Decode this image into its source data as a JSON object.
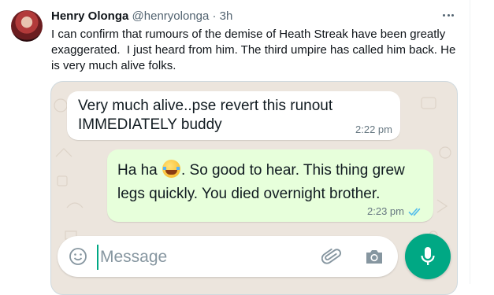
{
  "tweet": {
    "author_name": "Henry Olonga",
    "handle": "@henryolonga",
    "separator": "·",
    "time": "3h",
    "text": "I can confirm that rumours of the demise of Heath Streak have been greatly exaggerated.  I just heard from him. The third umpire has called him back. He is very much alive folks."
  },
  "chat": {
    "incoming": {
      "text": "Very much alive..pse revert this runout\nIMMEDIATELY buddy",
      "time": "2:22 pm"
    },
    "outgoing": {
      "text_before_emoji": "Ha ha ",
      "emoji": "face-with-tears-of-joy",
      "text_after_emoji": ".  So good to hear. This thing grew\nlegs quickly. You died overnight brother.",
      "time": "2:23 pm",
      "status": "read"
    },
    "input": {
      "placeholder": "Message",
      "value": ""
    },
    "icons": [
      "smiley-icon",
      "attach-icon",
      "camera-icon",
      "mic-icon"
    ]
  },
  "colors": {
    "accent": "#00a884",
    "outgoing_bubble": "#e7ffdb",
    "read_ticks": "#53bdeb",
    "chat_background": "#ece5dd"
  }
}
